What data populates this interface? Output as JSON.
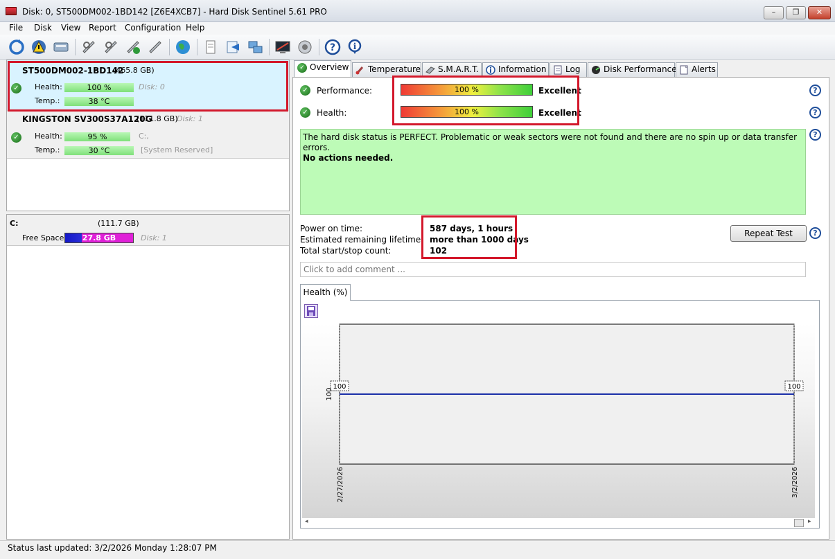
{
  "window": {
    "title": "Disk: 0, ST500DM002-1BD142 [Z6E4XCB7]  -  Hard Disk Sentinel 5.61 PRO",
    "min_label": "–",
    "max_label": "❐",
    "close_label": "✕"
  },
  "menu": [
    "File",
    "Disk",
    "View",
    "Report",
    "Configuration",
    "Help"
  ],
  "disks": [
    {
      "name": "ST500DM002-1BD142",
      "size": "(465.8 GB)",
      "health_label": "Health:",
      "health": "100 %",
      "health_pct": 100,
      "disk_label": "Disk: 0",
      "temp_label": "Temp.:",
      "temp": "38 °C",
      "extra": ""
    },
    {
      "name": "KINGSTON SV300S37A120G",
      "size": "(111.8 GB)",
      "disk_label": "Disk: 1",
      "health_label": "Health:",
      "health": "95 %",
      "health_pct": 95,
      "temp_label": "Temp.:",
      "temp": "30 °C",
      "drive": "C:,",
      "extra": "[System Reserved]"
    }
  ],
  "volume": {
    "letter": "C:",
    "size": "(111.7 GB)",
    "free_label": "Free Space",
    "free": "27.8 GB",
    "free_fraction": 0.249,
    "disk": "Disk: 1"
  },
  "tabs": [
    "Overview",
    "Temperature",
    "S.M.A.R.T.",
    "Information",
    "Log",
    "Disk Performance",
    "Alerts"
  ],
  "overview": {
    "performance_label": "Performance:",
    "performance_value": "100 %",
    "performance_rating": "Excellent",
    "health_label": "Health:",
    "health_value": "100 %",
    "health_rating": "Excellent",
    "status_text": "The hard disk status is PERFECT. Problematic or weak sectors were not found and there are no spin up or data transfer errors.",
    "actions_text": "No actions needed.",
    "power_on_label": "Power on time:",
    "power_on_value": "587 days, 1 hours",
    "lifetime_label": "Estimated remaining lifetime:",
    "lifetime_value": "more than 1000 days",
    "startstop_label": "Total start/stop count:",
    "startstop_value": "102",
    "repeat_test": "Repeat Test",
    "comment_placeholder": "Click to add comment ..."
  },
  "chart_tab": "Health (%)",
  "chart_data": {
    "type": "line",
    "x": [
      "2/27/2026",
      "3/2/2026"
    ],
    "series": [
      {
        "values": [
          100,
          100
        ]
      }
    ],
    "point_labels": [
      "100",
      "100"
    ],
    "ytick": "100",
    "ylim": [
      0,
      200
    ],
    "grid": false,
    "colors": {
      "line": "#1b2fa8"
    }
  },
  "statusbar": "Status last updated: 3/2/2026 Monday 1:28:07 PM",
  "colors": {
    "accent_red": "#d3182b",
    "status_green": "#bdfbb7",
    "selected": "#d9f3ff"
  }
}
